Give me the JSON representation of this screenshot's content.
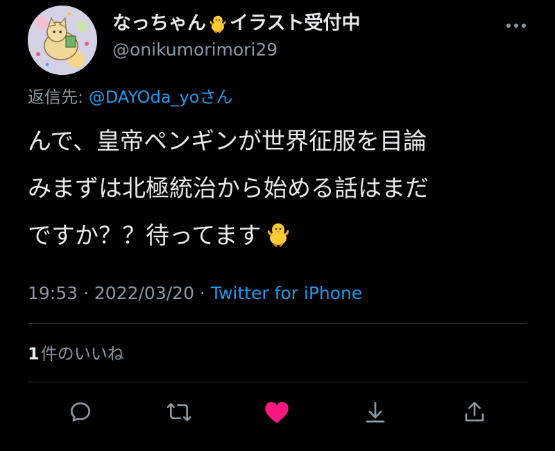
{
  "profile": {
    "display_name_part1": "なっちゃん",
    "display_name_emoji": "chick-emoji",
    "display_name_part2": "イラスト受付中",
    "handle": "@onikumorimori29"
  },
  "reply": {
    "label": "返信先: ",
    "mention": "@DAYOda_yo",
    "suffix": "さん"
  },
  "tweet": {
    "lines": [
      "んで、皇帝ペンギンが世界征服を目論",
      "みまずは北極統治から始める話はまだ",
      "ですか？？待ってます"
    ],
    "trailing_emoji": "chick-emoji"
  },
  "meta": {
    "time": "19:53",
    "separator1": " · ",
    "date": "2022/03/20",
    "separator2": " · ",
    "source": "Twitter for iPhone"
  },
  "likes": {
    "count": "1",
    "label": "件のいいね"
  },
  "actions": [
    {
      "icon": "reply-icon"
    },
    {
      "icon": "retweet-icon"
    },
    {
      "icon": "like-icon"
    },
    {
      "icon": "download-icon"
    },
    {
      "icon": "share-icon"
    }
  ],
  "colors": {
    "background": "#000000",
    "text": "#e7e9ea",
    "secondary": "#8b98a5",
    "accent": "#1d9bf0",
    "like": "#f91880",
    "divider": "#2f3336"
  }
}
